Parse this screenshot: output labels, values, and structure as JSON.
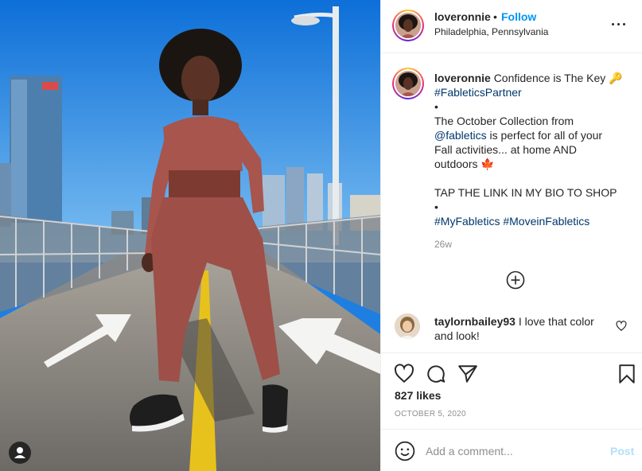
{
  "post": {
    "username": "loveronnie",
    "dot": "•",
    "follow_label": "Follow",
    "location": "Philadelphia, Pennsylvania",
    "caption": {
      "username": "loveronnie",
      "line1_text": "Confidence is The Key 🔑",
      "hashtag_partner": "#FableticsPartner",
      "bullet": "•",
      "line_collection": "The October Collection from",
      "mention": "@fabletics",
      "line_mention_rest": "is perfect for all of your",
      "line_fall": "Fall activities... at home AND",
      "line_outdoors": "outdoors 🍁",
      "line_tap": "TAP THE LINK IN MY BIO TO SHOP",
      "hashtag_my": "#MyFabletics",
      "hashtag_move": "#MoveinFabletics"
    },
    "time_ago": "26w",
    "comment": {
      "username": "taylornbailey93",
      "text": "I love that color and look!"
    },
    "likes": "827 likes",
    "date": "OCTOBER 5, 2020",
    "add_comment_placeholder": "Add a comment...",
    "post_label": "Post"
  },
  "icons": {
    "more": "more-options-icon",
    "load_more": "plus-circle-icon",
    "comment_like": "heart-icon",
    "like": "heart-icon",
    "comment": "comment-icon",
    "share": "send-icon",
    "save": "bookmark-icon",
    "emoji": "emoji-icon",
    "tagged_user": "user-tag-icon"
  },
  "colors": {
    "link_blue": "#0095f6",
    "hashtag_blue": "#00376b",
    "text": "#262626",
    "secondary": "#8e8e8e",
    "post_disabled": "#b2dffc"
  }
}
